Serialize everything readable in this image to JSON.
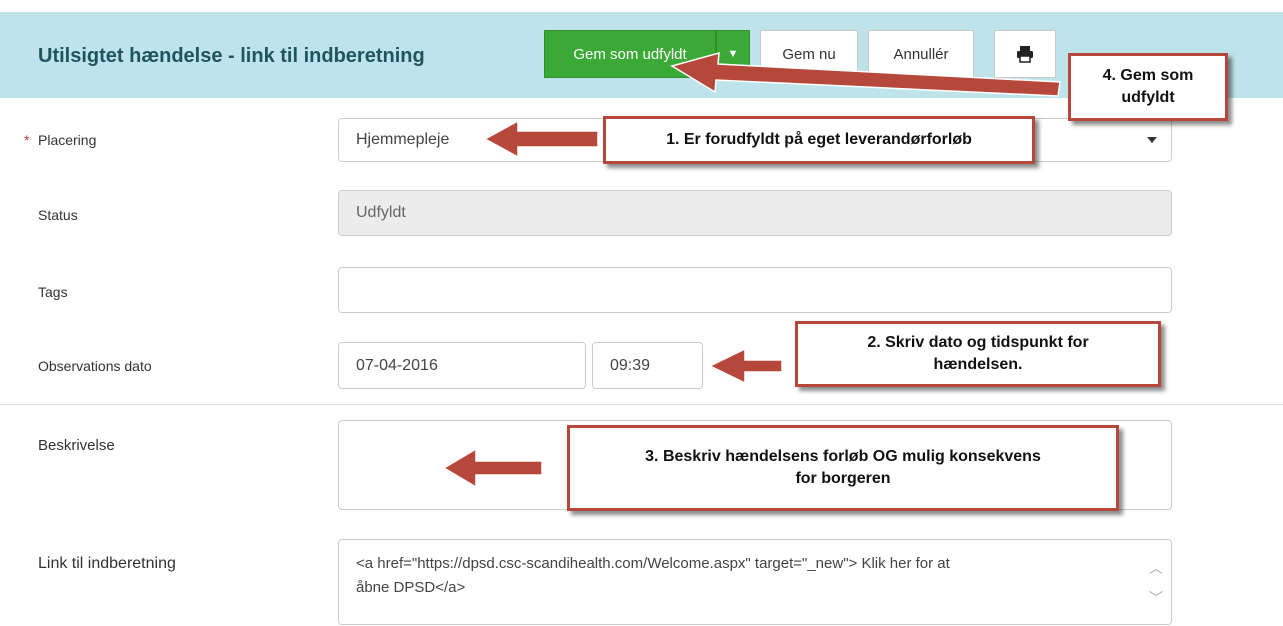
{
  "header": {
    "title": "Utilsigtet hændelse - link til indberetning",
    "primary_button": "Gem som udfyldt",
    "save_now_button": "Gem nu",
    "cancel_button": "Annullér",
    "print_icon": "print-icon"
  },
  "form": {
    "placering": {
      "label": "Placering",
      "required_marker": "*",
      "value": "Hjemmepleje"
    },
    "status": {
      "label": "Status",
      "value": "Udfyldt"
    },
    "tags": {
      "label": "Tags",
      "value": ""
    },
    "observation": {
      "label": "Observations dato",
      "date": "07-04-2016",
      "time": "09:39"
    },
    "beskrivelse": {
      "label": "Beskrivelse",
      "value": ""
    },
    "link": {
      "label": "Link til indberetning",
      "line1": "<a href=\"https://dpsd.csc-scandihealth.com/Welcome.aspx\" target=\"_new\"> Klik her for at",
      "line2": "åbne DPSD</a>"
    }
  },
  "callouts": {
    "c1": "1. Er forudfyldt på eget leverandørforløb",
    "c2_line1": "2. Skriv dato og tidspunkt for",
    "c2_line2": "hændelsen.",
    "c3_line1": "3. Beskriv hændelsens forløb OG mulig konsekvens",
    "c3_line2": "for borgeren",
    "c4_line1": "4. Gem som",
    "c4_line2": "udfyldt"
  },
  "colors": {
    "header_bg": "#bfe3ea",
    "primary_green": "#3aa935",
    "annotation_red": "#b5483a"
  }
}
